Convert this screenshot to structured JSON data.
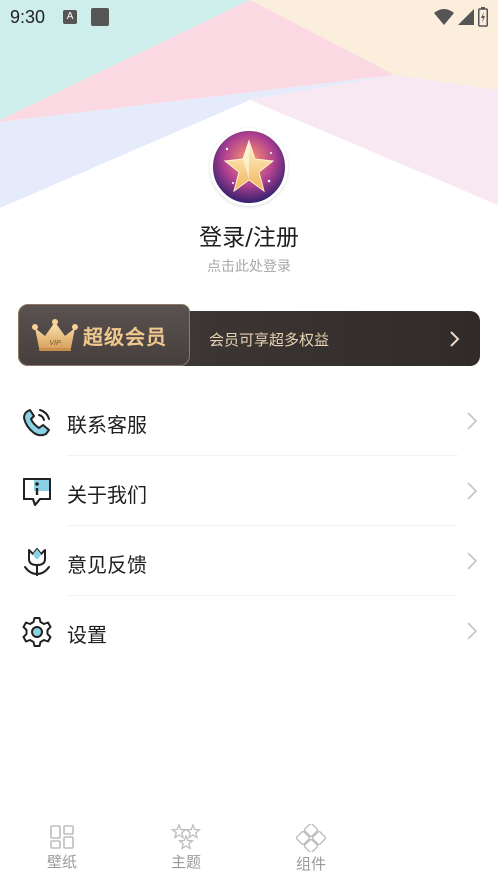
{
  "status_bar": {
    "time": "9:30",
    "notification_icon_letter": "A",
    "icons": [
      "wifi-icon",
      "signal-icon",
      "battery-icon"
    ]
  },
  "profile": {
    "title": "登录/注册",
    "subtitle": "点击此处登录",
    "avatar_icon": "star-avatar-icon"
  },
  "vip": {
    "badge_text": "VIP",
    "title": "超级会员",
    "description": "会员可享超多权益",
    "colors": {
      "gold": "#f1c98e",
      "dark": "#3b3533"
    }
  },
  "menu": {
    "items": [
      {
        "label": "联系客服",
        "icon": "phone-icon"
      },
      {
        "label": "关于我们",
        "icon": "info-icon"
      },
      {
        "label": "意见反馈",
        "icon": "tulip-icon"
      },
      {
        "label": "设置",
        "icon": "gear-icon"
      }
    ]
  },
  "bottom_nav": {
    "items": [
      {
        "label": "壁纸",
        "icon": "grid-icon"
      },
      {
        "label": "主题",
        "icon": "stars-icon"
      },
      {
        "label": "组件",
        "icon": "widget-icon"
      }
    ]
  }
}
